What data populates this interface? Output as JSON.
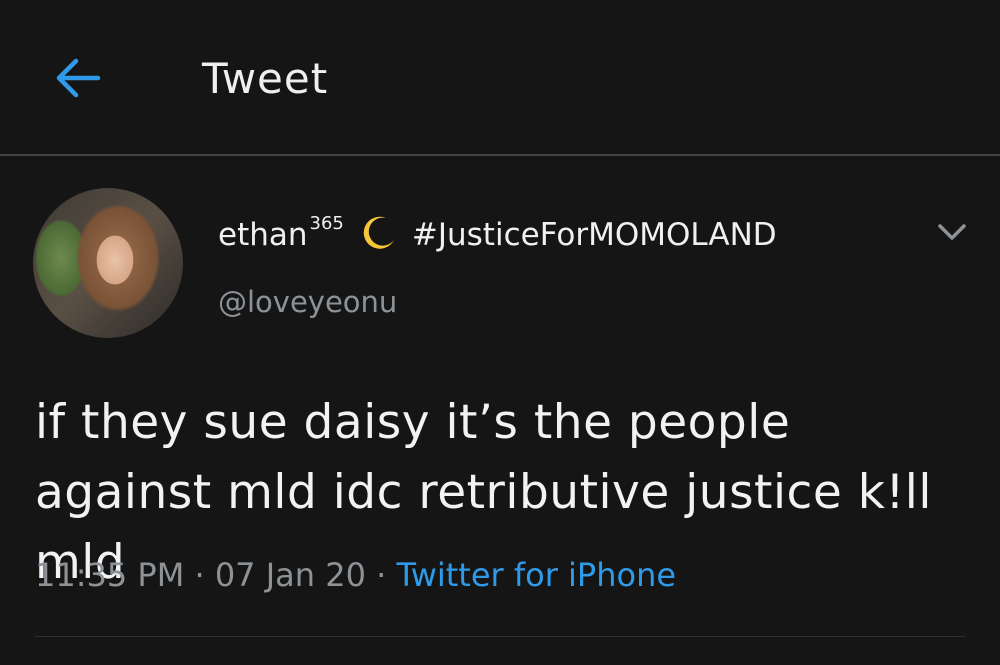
{
  "header": {
    "title": "Tweet",
    "back_icon": "arrow-left-icon"
  },
  "tweet": {
    "display_name": "ethan",
    "display_name_sup": "365",
    "display_name_emoji": "crescent-moon-icon",
    "hashtag": "#JusticeForMOMOLAND",
    "handle": "@loveyeonu",
    "text": "if they sue daisy it’s the people against mld idc retributive justice k!ll mld",
    "time": "11:35 PM",
    "sep1": " · ",
    "date": "07 Jan 20",
    "sep2": " · ",
    "source": "Twitter for iPhone",
    "menu_icon": "chevron-down-icon"
  },
  "colors": {
    "background": "#151515",
    "accent": "#2f9be8",
    "secondary_text": "#8d9297",
    "moon": "#f5c53a"
  }
}
